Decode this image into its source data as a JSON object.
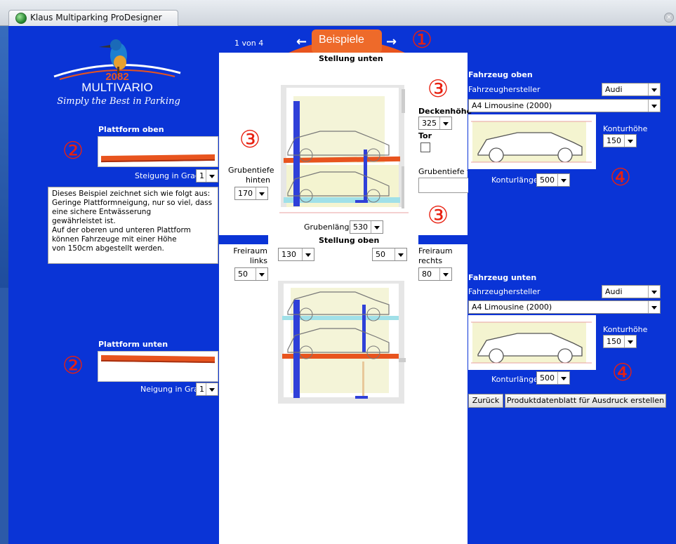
{
  "window": {
    "title": "Klaus Multiparking ProDesigner"
  },
  "nav": {
    "counter": "1 von 4",
    "examples_label": "Beispiele",
    "prev_arrow": "←",
    "next_arrow": "→"
  },
  "logo": {
    "number": "2082",
    "name": "MULTIVARIO",
    "tagline": "Simply the Best in Parking"
  },
  "markers": [
    "①",
    "②",
    "③",
    "④"
  ],
  "platform_top": {
    "title": "Plattform oben",
    "slope_label": "Steigung in Grad",
    "slope_value": "1"
  },
  "platform_bottom": {
    "title": "Plattform unten",
    "slope_label": "Neigung in Grad",
    "slope_value": "1"
  },
  "description": "Dieses Beispiel zeichnet sich wie folgt aus:\nGeringe Plattformneigung, nur so viel, dass eine sichere Entwässerung\ngewährleistet ist.\nAuf der oberen und unteren Plattform können Fahrzeuge mit einer Höhe\nvon 150cm abgestellt werden.",
  "stellung_unten": {
    "title": "Stellung unten",
    "grubentiefe_hinten_label": "Grubentiefe hinten",
    "grubentiefe_hinten_value": "170",
    "deckenhoehe_label": "Deckenhöhe",
    "deckenhoehe_value": "325",
    "tor_label": "Tor",
    "grubentiefe_vorne_label": "Grubentiefe vo",
    "grubenlaenge_label": "Grubenlänge",
    "grubenlaenge_value": "530"
  },
  "stellung_oben": {
    "title": "Stellung oben",
    "freiraum_links_label": "Freiraum links",
    "freiraum_links_value": "50",
    "freiraum_rechts_label": "Freiraum rechts",
    "freiraum_rechts_value": "80",
    "mid_left_value": "130",
    "mid_right_value": "50"
  },
  "vehicle_top": {
    "title": "Fahrzeug oben",
    "maker_label": "Fahrzeughersteller",
    "maker_value": "Audi",
    "model_value": "A4 Limousine (2000)",
    "kontur_hoehe_label": "Konturhöhe",
    "kontur_hoehe_value": "150",
    "kontur_laenge_label": "Konturlänge",
    "kontur_laenge_value": "500"
  },
  "vehicle_bottom": {
    "title": "Fahrzeug unten",
    "maker_label": "Fahrzeughersteller",
    "maker_value": "Audi",
    "model_value": "A4 Limousine (2000)",
    "kontur_hoehe_label": "Konturhöhe",
    "kontur_hoehe_value": "150",
    "kontur_laenge_label": "Konturlänge",
    "kontur_laenge_value": "500"
  },
  "actions": {
    "back": "Zurück",
    "print": "Produktdatenblatt für Ausdruck erstellen"
  },
  "colors": {
    "app_bg": "#0a34d6",
    "platform": "#e8541e",
    "marker": "#e82010",
    "pillar": "#2f40d8"
  }
}
